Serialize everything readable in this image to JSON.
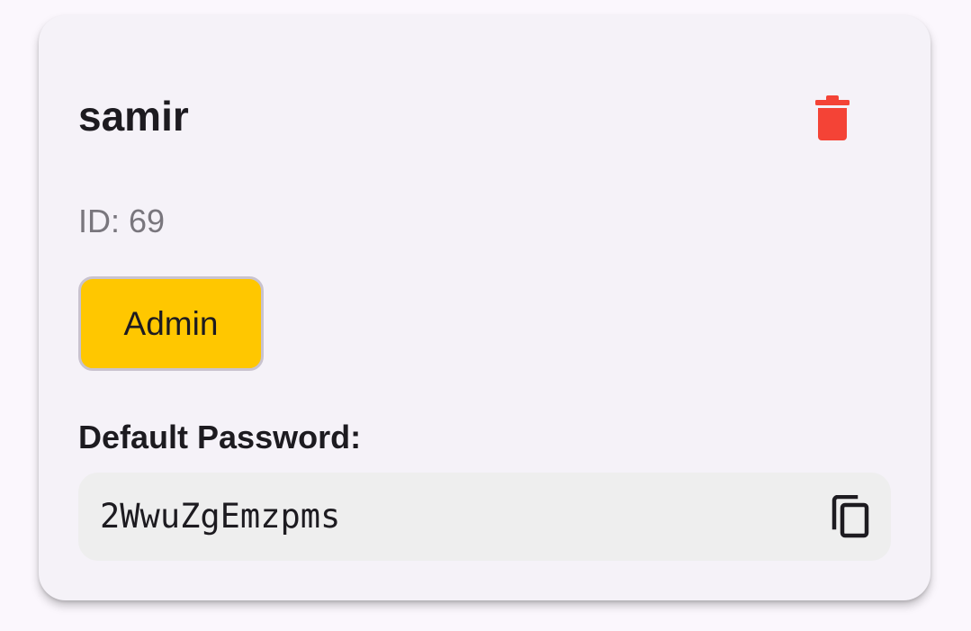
{
  "user": {
    "name": "samir",
    "id_text": "ID: 69",
    "role": "Admin"
  },
  "password": {
    "label": "Default Password:",
    "value": "2WwuZgEmzpms"
  },
  "icons": {
    "delete": "trash-icon",
    "copy": "copy-icon"
  },
  "colors": {
    "delete": "#f44336",
    "role_chip": "#ffc700"
  }
}
